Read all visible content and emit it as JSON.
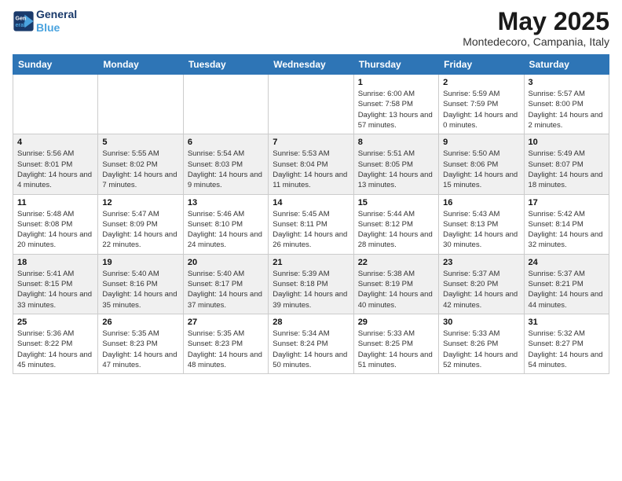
{
  "header": {
    "logo_line1": "General",
    "logo_line2": "Blue",
    "month": "May 2025",
    "location": "Montedecoro, Campania, Italy"
  },
  "weekdays": [
    "Sunday",
    "Monday",
    "Tuesday",
    "Wednesday",
    "Thursday",
    "Friday",
    "Saturday"
  ],
  "weeks": [
    [
      {
        "day": "",
        "sunrise": "",
        "sunset": "",
        "daylight": "",
        "empty": true
      },
      {
        "day": "",
        "sunrise": "",
        "sunset": "",
        "daylight": "",
        "empty": true
      },
      {
        "day": "",
        "sunrise": "",
        "sunset": "",
        "daylight": "",
        "empty": true
      },
      {
        "day": "",
        "sunrise": "",
        "sunset": "",
        "daylight": "",
        "empty": true
      },
      {
        "day": "1",
        "sunrise": "Sunrise: 6:00 AM",
        "sunset": "Sunset: 7:58 PM",
        "daylight": "Daylight: 13 hours and 57 minutes."
      },
      {
        "day": "2",
        "sunrise": "Sunrise: 5:59 AM",
        "sunset": "Sunset: 7:59 PM",
        "daylight": "Daylight: 14 hours and 0 minutes."
      },
      {
        "day": "3",
        "sunrise": "Sunrise: 5:57 AM",
        "sunset": "Sunset: 8:00 PM",
        "daylight": "Daylight: 14 hours and 2 minutes."
      }
    ],
    [
      {
        "day": "4",
        "sunrise": "Sunrise: 5:56 AM",
        "sunset": "Sunset: 8:01 PM",
        "daylight": "Daylight: 14 hours and 4 minutes."
      },
      {
        "day": "5",
        "sunrise": "Sunrise: 5:55 AM",
        "sunset": "Sunset: 8:02 PM",
        "daylight": "Daylight: 14 hours and 7 minutes."
      },
      {
        "day": "6",
        "sunrise": "Sunrise: 5:54 AM",
        "sunset": "Sunset: 8:03 PM",
        "daylight": "Daylight: 14 hours and 9 minutes."
      },
      {
        "day": "7",
        "sunrise": "Sunrise: 5:53 AM",
        "sunset": "Sunset: 8:04 PM",
        "daylight": "Daylight: 14 hours and 11 minutes."
      },
      {
        "day": "8",
        "sunrise": "Sunrise: 5:51 AM",
        "sunset": "Sunset: 8:05 PM",
        "daylight": "Daylight: 14 hours and 13 minutes."
      },
      {
        "day": "9",
        "sunrise": "Sunrise: 5:50 AM",
        "sunset": "Sunset: 8:06 PM",
        "daylight": "Daylight: 14 hours and 15 minutes."
      },
      {
        "day": "10",
        "sunrise": "Sunrise: 5:49 AM",
        "sunset": "Sunset: 8:07 PM",
        "daylight": "Daylight: 14 hours and 18 minutes."
      }
    ],
    [
      {
        "day": "11",
        "sunrise": "Sunrise: 5:48 AM",
        "sunset": "Sunset: 8:08 PM",
        "daylight": "Daylight: 14 hours and 20 minutes."
      },
      {
        "day": "12",
        "sunrise": "Sunrise: 5:47 AM",
        "sunset": "Sunset: 8:09 PM",
        "daylight": "Daylight: 14 hours and 22 minutes."
      },
      {
        "day": "13",
        "sunrise": "Sunrise: 5:46 AM",
        "sunset": "Sunset: 8:10 PM",
        "daylight": "Daylight: 14 hours and 24 minutes."
      },
      {
        "day": "14",
        "sunrise": "Sunrise: 5:45 AM",
        "sunset": "Sunset: 8:11 PM",
        "daylight": "Daylight: 14 hours and 26 minutes."
      },
      {
        "day": "15",
        "sunrise": "Sunrise: 5:44 AM",
        "sunset": "Sunset: 8:12 PM",
        "daylight": "Daylight: 14 hours and 28 minutes."
      },
      {
        "day": "16",
        "sunrise": "Sunrise: 5:43 AM",
        "sunset": "Sunset: 8:13 PM",
        "daylight": "Daylight: 14 hours and 30 minutes."
      },
      {
        "day": "17",
        "sunrise": "Sunrise: 5:42 AM",
        "sunset": "Sunset: 8:14 PM",
        "daylight": "Daylight: 14 hours and 32 minutes."
      }
    ],
    [
      {
        "day": "18",
        "sunrise": "Sunrise: 5:41 AM",
        "sunset": "Sunset: 8:15 PM",
        "daylight": "Daylight: 14 hours and 33 minutes."
      },
      {
        "day": "19",
        "sunrise": "Sunrise: 5:40 AM",
        "sunset": "Sunset: 8:16 PM",
        "daylight": "Daylight: 14 hours and 35 minutes."
      },
      {
        "day": "20",
        "sunrise": "Sunrise: 5:40 AM",
        "sunset": "Sunset: 8:17 PM",
        "daylight": "Daylight: 14 hours and 37 minutes."
      },
      {
        "day": "21",
        "sunrise": "Sunrise: 5:39 AM",
        "sunset": "Sunset: 8:18 PM",
        "daylight": "Daylight: 14 hours and 39 minutes."
      },
      {
        "day": "22",
        "sunrise": "Sunrise: 5:38 AM",
        "sunset": "Sunset: 8:19 PM",
        "daylight": "Daylight: 14 hours and 40 minutes."
      },
      {
        "day": "23",
        "sunrise": "Sunrise: 5:37 AM",
        "sunset": "Sunset: 8:20 PM",
        "daylight": "Daylight: 14 hours and 42 minutes."
      },
      {
        "day": "24",
        "sunrise": "Sunrise: 5:37 AM",
        "sunset": "Sunset: 8:21 PM",
        "daylight": "Daylight: 14 hours and 44 minutes."
      }
    ],
    [
      {
        "day": "25",
        "sunrise": "Sunrise: 5:36 AM",
        "sunset": "Sunset: 8:22 PM",
        "daylight": "Daylight: 14 hours and 45 minutes."
      },
      {
        "day": "26",
        "sunrise": "Sunrise: 5:35 AM",
        "sunset": "Sunset: 8:23 PM",
        "daylight": "Daylight: 14 hours and 47 minutes."
      },
      {
        "day": "27",
        "sunrise": "Sunrise: 5:35 AM",
        "sunset": "Sunset: 8:23 PM",
        "daylight": "Daylight: 14 hours and 48 minutes."
      },
      {
        "day": "28",
        "sunrise": "Sunrise: 5:34 AM",
        "sunset": "Sunset: 8:24 PM",
        "daylight": "Daylight: 14 hours and 50 minutes."
      },
      {
        "day": "29",
        "sunrise": "Sunrise: 5:33 AM",
        "sunset": "Sunset: 8:25 PM",
        "daylight": "Daylight: 14 hours and 51 minutes."
      },
      {
        "day": "30",
        "sunrise": "Sunrise: 5:33 AM",
        "sunset": "Sunset: 8:26 PM",
        "daylight": "Daylight: 14 hours and 52 minutes."
      },
      {
        "day": "31",
        "sunrise": "Sunrise: 5:32 AM",
        "sunset": "Sunset: 8:27 PM",
        "daylight": "Daylight: 14 hours and 54 minutes."
      }
    ]
  ],
  "colors": {
    "header_bg": "#2e75b6",
    "header_text": "#ffffff",
    "accent_blue": "#1a3a6b",
    "logo_blue": "#4aa3df"
  }
}
